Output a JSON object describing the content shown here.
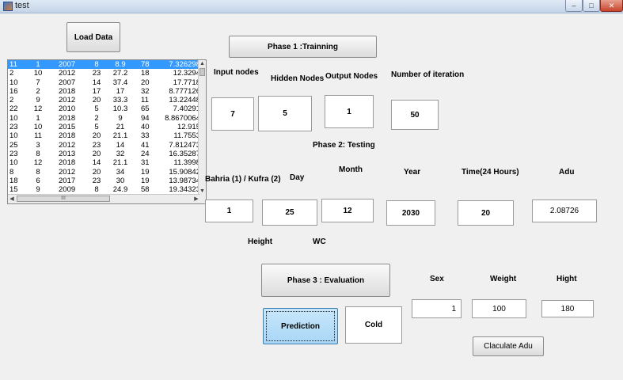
{
  "window": {
    "title": "test"
  },
  "buttons": {
    "load_data": "Load Data",
    "phase1": "Phase 1 :Trainning",
    "phase3": "Phase 3 : Evaluation",
    "prediction": "Prediction",
    "calculate_adu": "Claculate Adu"
  },
  "table": {
    "rows": [
      [
        "11",
        "1",
        "2007",
        "8",
        "8.9",
        "78",
        "7.326298"
      ],
      [
        "2",
        "10",
        "2012",
        "23",
        "27.2",
        "18",
        "12.3294"
      ],
      [
        "10",
        "7",
        "2007",
        "14",
        "37.4",
        "20",
        "17.7718"
      ],
      [
        "16",
        "2",
        "2018",
        "17",
        "17",
        "32",
        "8.777126"
      ],
      [
        "2",
        "9",
        "2012",
        "20",
        "33.3",
        "11",
        "13.22448"
      ],
      [
        "22",
        "12",
        "2010",
        "5",
        "10.3",
        "65",
        "7.40291"
      ],
      [
        "10",
        "1",
        "2018",
        "2",
        "9",
        "94",
        "8.8670064"
      ],
      [
        "23",
        "10",
        "2015",
        "5",
        "21",
        "40",
        "12.915"
      ],
      [
        "10",
        "11",
        "2018",
        "20",
        "21.1",
        "33",
        "11.7553"
      ],
      [
        "25",
        "3",
        "2012",
        "23",
        "14",
        "41",
        "7.812473"
      ],
      [
        "23",
        "8",
        "2013",
        "20",
        "32",
        "24",
        "16.35287"
      ],
      [
        "10",
        "12",
        "2018",
        "14",
        "21.1",
        "31",
        "11.3998"
      ],
      [
        "8",
        "8",
        "2012",
        "20",
        "34",
        "19",
        "15.90842"
      ],
      [
        "18",
        "6",
        "2017",
        "23",
        "30",
        "19",
        "13.98734"
      ],
      [
        "15",
        "9",
        "2009",
        "8",
        "24.9",
        "58",
        "19.34323"
      ]
    ],
    "hscroll_thumb": "III"
  },
  "training": {
    "input_nodes_label": "Input nodes",
    "hidden_nodes_label": "Hidden Nodes",
    "output_nodes_label": "Output Nodes",
    "iterations_label": "Number of iteration",
    "input_nodes": "7",
    "hidden_nodes": "5",
    "output_nodes": "1",
    "iterations": "50"
  },
  "testing": {
    "title": "Phase 2: Testing",
    "site_label": "Bahria (1) / Kufra (2)",
    "day_label": "Day",
    "month_label": "Month",
    "year_label": "Year",
    "time_label": "Time(24 Hours)",
    "adu_label": "Adu",
    "site": "1",
    "day": "25",
    "month": "12",
    "year": "2030",
    "time": "20",
    "adu": "2.08726",
    "height_label": "Height",
    "wc_label": "WC"
  },
  "evaluation": {
    "sex_label": "Sex",
    "weight_label": "Weight",
    "hight_label": "Hight",
    "sex": "1",
    "weight": "100",
    "hight": "180",
    "result": "Cold"
  }
}
